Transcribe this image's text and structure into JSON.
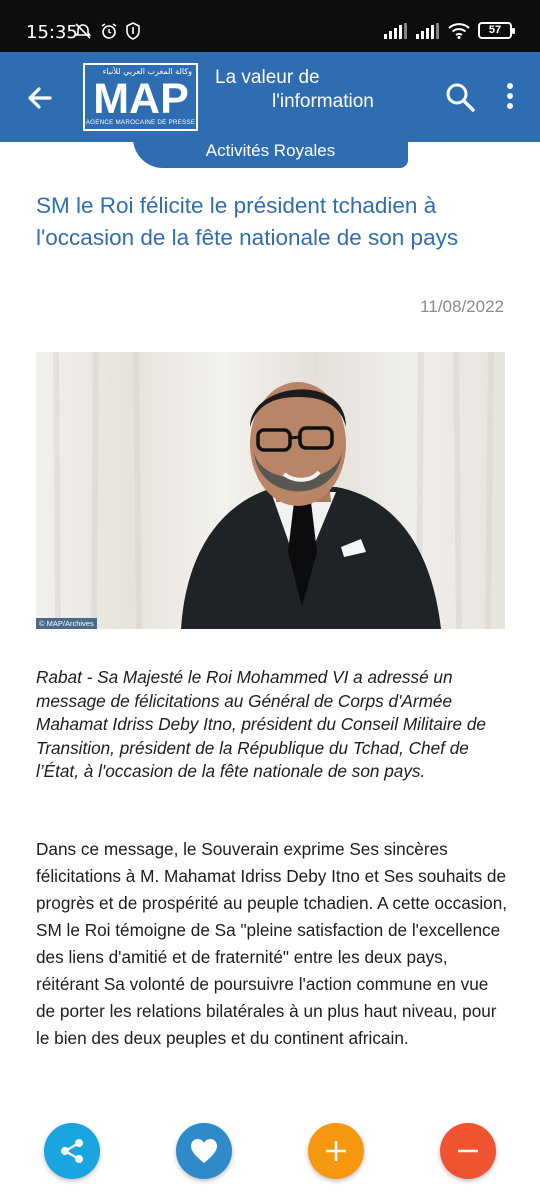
{
  "status_bar": {
    "time": "15:35",
    "icons_left": [
      "alarm-off-icon",
      "alarm-icon",
      "vpn-icon"
    ],
    "battery": "57"
  },
  "app_bar": {
    "logo_arabic": "وكالة المغرب العربي للأنباء",
    "logo_text": "MAP",
    "logo_subtitle": "AGENCE MAROCAINE DE PRESSE",
    "tagline_line1": "La valeur de",
    "tagline_line2": "l'information"
  },
  "category": "Activités Royales",
  "article": {
    "title": "SM le Roi félicite le président tchadien à l'occasion de la fête nationale de son pays",
    "date": "11/08/2022",
    "image_credit": "© MAP/Archives",
    "lead": "Rabat - Sa Majesté le Roi Mohammed VI a adressé un message de félicitations au Général de Corps d'Armée Mahamat Idriss Deby Itno, président du Conseil Militaire de Transition, président de la République du Tchad, Chef de l’État, à l'occasion de la fête nationale de son pays.",
    "body": "Dans ce message, le Souverain exprime Ses sincères félicitations à M. Mahamat Idriss Deby Itno et Ses souhaits de progrès et de prospérité au peuple tchadien. A cette occasion, SM le Roi témoigne de Sa \"pleine satisfaction de l'excellence des liens d'amitié et de fraternité\" entre les deux pays, réitérant Sa volonté de poursuivre l'action commune en vue de porter les relations bilatérales à un plus haut niveau, pour le bien des deux peuples et du continent africain."
  },
  "actions": [
    {
      "name": "share",
      "color": "#1aa4e0",
      "icon": "share-icon"
    },
    {
      "name": "like",
      "color": "#2e8ac8",
      "icon": "heart-icon"
    },
    {
      "name": "zoom-in",
      "color": "#f5970f",
      "icon": "plus-icon"
    },
    {
      "name": "zoom-out",
      "color": "#f0532f",
      "icon": "minus-icon"
    }
  ],
  "colors": {
    "brand_blue": "#2f6db3",
    "title_blue": "#2f6db3",
    "status_bar": "#0d0d0d"
  }
}
